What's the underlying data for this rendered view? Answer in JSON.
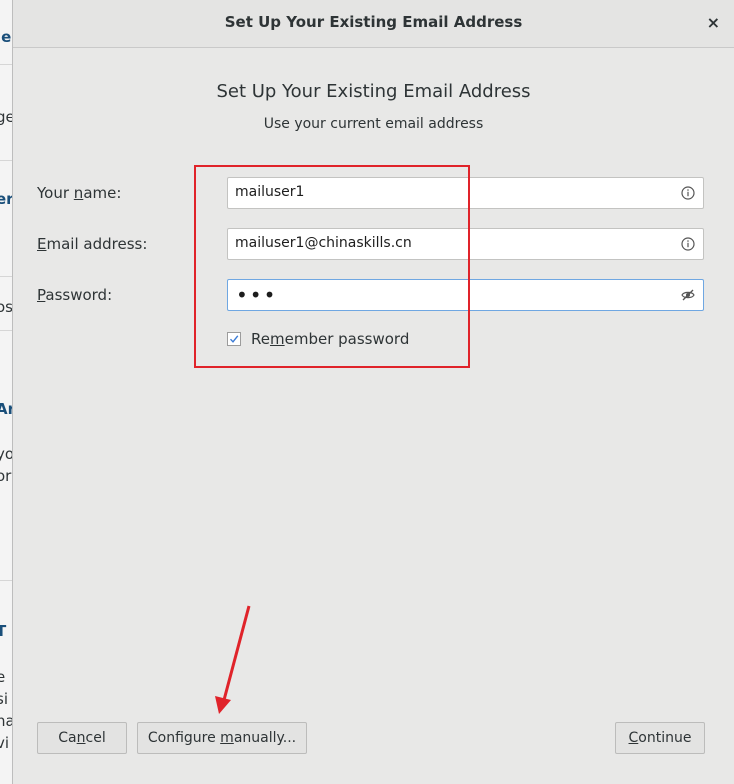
{
  "dialog": {
    "window_title": "Set Up Your Existing Email Address",
    "close_glyph": "×",
    "heading": "Set Up Your Existing Email Address",
    "subheading": "Use your current email address"
  },
  "form": {
    "name": {
      "label": "Your name:",
      "value": "mailuser1",
      "icon": "info-icon"
    },
    "email": {
      "label": "Email address:",
      "value": "mailuser1@chinaskills.cn",
      "icon": "info-icon"
    },
    "password": {
      "label": "Password:",
      "masked_value": "•••",
      "icon": "eye-slash-icon"
    },
    "remember": {
      "label": "Remember password",
      "checked": true
    }
  },
  "buttons": {
    "cancel": "Cancel",
    "configure": "Configure manually...",
    "continue": "Continue"
  },
  "annotations": {
    "highlight_color": "#e0232a"
  },
  "background": {
    "fragments": [
      "le",
      "ge",
      "er",
      "os",
      "Ar",
      "yo",
      "or",
      "T",
      "e",
      "si",
      "na",
      "vi"
    ]
  }
}
